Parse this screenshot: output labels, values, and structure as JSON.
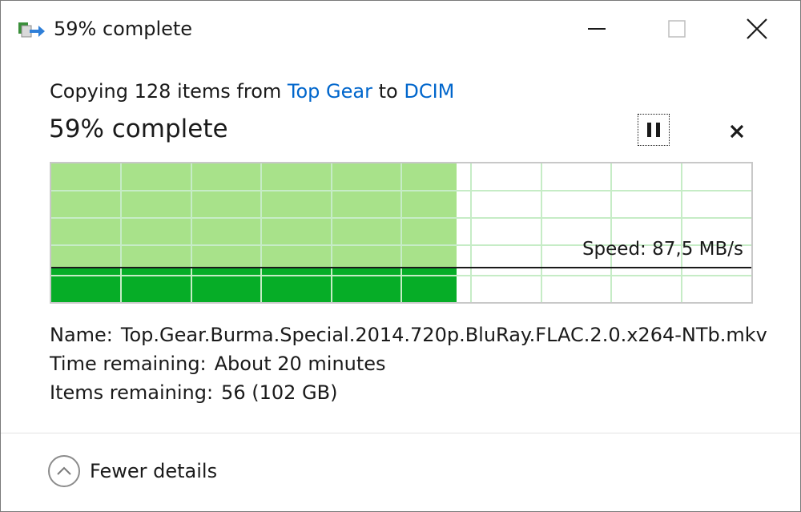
{
  "window": {
    "title": "59% complete",
    "icons": {
      "app": "file-copy-icon",
      "minimize": "minimize-icon",
      "maximize": "maximize-icon",
      "close": "close-icon"
    }
  },
  "header": {
    "copy_prefix": "Copying 128 items from ",
    "source": "Top Gear",
    "to_word": " to ",
    "destination": "DCIM",
    "status": "59% complete",
    "progress_percent": 59
  },
  "controls": {
    "pause_icon": "pause-icon",
    "cancel_icon": "cancel-x-icon"
  },
  "graph": {
    "speed_text": "Speed: 87,5 MB/s",
    "colors": {
      "fill_light": "#a8e28a",
      "fill_dark": "#06ad27",
      "grid": "#c6ecc6",
      "line": "#1a1a1a"
    }
  },
  "details": {
    "name_label": "Name:",
    "name_value": "Top.Gear.Burma.Special.2014.720p.BluRay.FLAC.2.0.x264-NTb.mkv",
    "time_label": "Time remaining:",
    "time_value": "About 20 minutes",
    "items_label": "Items remaining:",
    "items_value": "56 (102 GB)"
  },
  "footer": {
    "toggle_label": "Fewer details",
    "toggle_icon": "chevron-up-icon"
  }
}
